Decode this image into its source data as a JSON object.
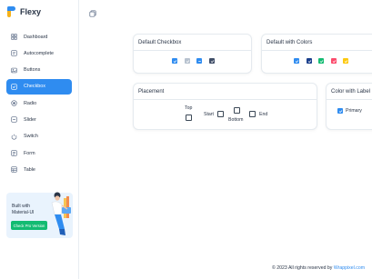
{
  "brand": {
    "name": "Flexy"
  },
  "sidebar": {
    "items": [
      {
        "label": "Dashboard",
        "icon": "dashboard-icon"
      },
      {
        "label": "Autocomplete",
        "icon": "autocomplete-icon"
      },
      {
        "label": "Buttons",
        "icon": "buttons-icon"
      },
      {
        "label": "Checkbox",
        "icon": "checkbox-icon",
        "active": true
      },
      {
        "label": "Radio",
        "icon": "radio-icon"
      },
      {
        "label": "Slider",
        "icon": "slider-icon"
      },
      {
        "label": "Switch",
        "icon": "switch-icon"
      },
      {
        "label": "Form",
        "icon": "form-icon"
      },
      {
        "label": "Table",
        "icon": "table-icon"
      }
    ],
    "promo": {
      "line1": "Built with",
      "line2": "Material-UI",
      "button": "Check Pro Version"
    }
  },
  "cards": {
    "default_checkbox": {
      "title": "Default Checkbox"
    },
    "default_colors": {
      "title": "Default with Colors"
    },
    "placement": {
      "title": "Placement",
      "top": "Top",
      "start": "Start",
      "bottom": "Bottom",
      "end": "End"
    },
    "color_label": {
      "title": "Color with Label",
      "primary": "Primary"
    }
  },
  "footer": {
    "text": "© 2023 All rights reserved by ",
    "link": "Wrappixel.com"
  },
  "colors": {
    "primary": "#2f8cf0",
    "secondary": "#1a97f5",
    "success": "#13bb72",
    "error": "#fc4b6c",
    "warning": "#fdc90f",
    "dark": "#3f4d67",
    "disabled": "#b7c2cf"
  }
}
